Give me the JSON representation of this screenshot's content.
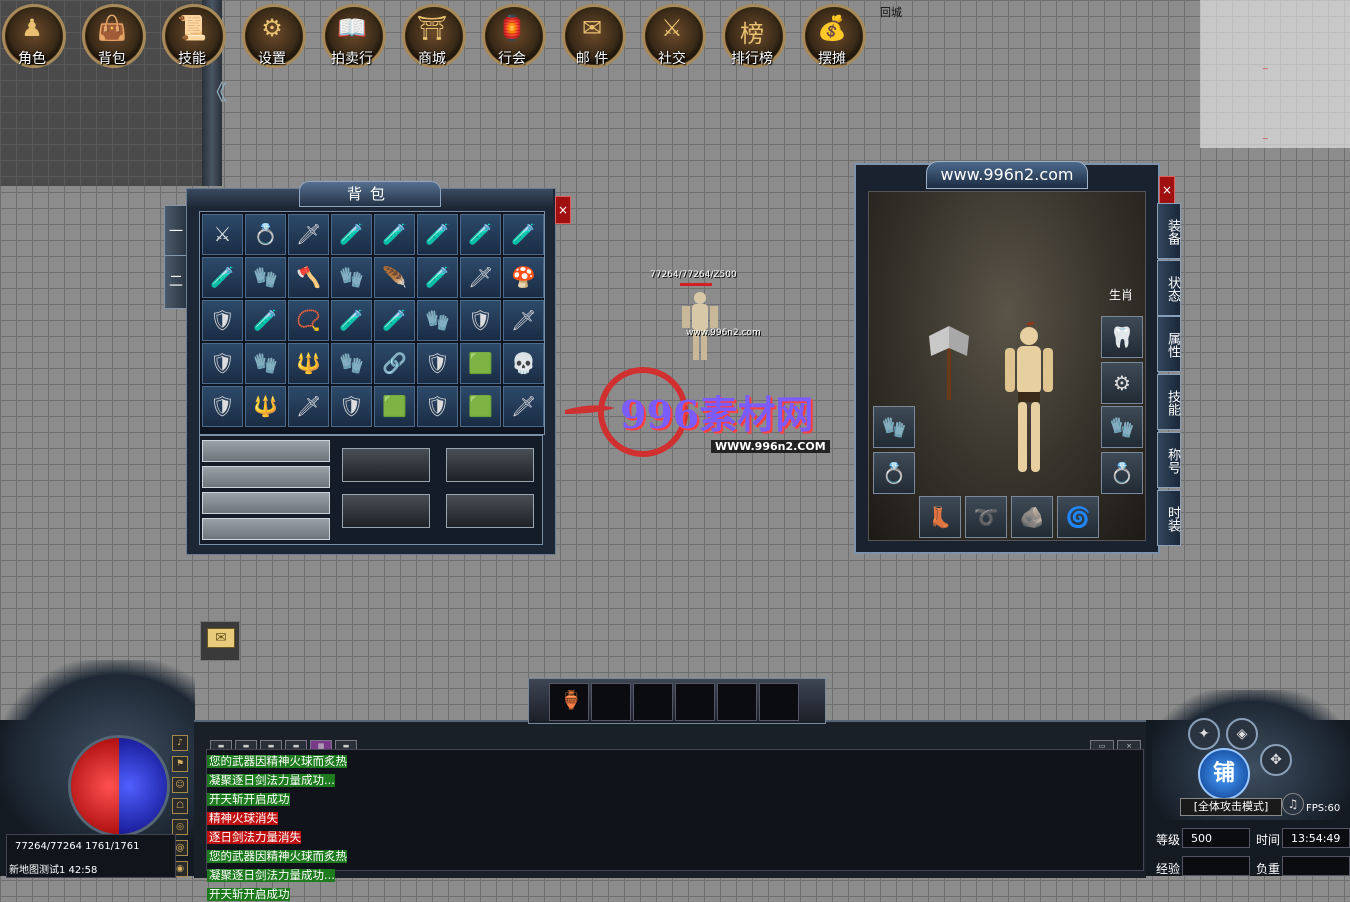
{
  "menu": [
    {
      "label": "角色",
      "icon": "character-icon",
      "glyph": "♟"
    },
    {
      "label": "背包",
      "icon": "bag-icon",
      "glyph": "👜"
    },
    {
      "label": "技能",
      "icon": "skill-icon",
      "glyph": "📜"
    },
    {
      "label": "设置",
      "icon": "gear-icon",
      "glyph": "⚙"
    },
    {
      "label": "拍卖行",
      "icon": "auction-icon",
      "glyph": "📖"
    },
    {
      "label": "商城",
      "icon": "shop-icon",
      "glyph": "⛩"
    },
    {
      "label": "行会",
      "icon": "guild-icon",
      "glyph": "🏮"
    },
    {
      "label": "邮 件",
      "icon": "mail-icon",
      "glyph": "✉"
    },
    {
      "label": "社交",
      "icon": "social-icon",
      "glyph": "⚔"
    },
    {
      "label": "排行榜",
      "icon": "rank-icon",
      "glyph": "榜"
    },
    {
      "label": "摆摊",
      "icon": "stall-icon",
      "glyph": "💰"
    }
  ],
  "return_city": "回城",
  "bag": {
    "title": "背包",
    "side_tabs": [
      "一",
      "二"
    ],
    "close": "×",
    "items": [
      "⚔",
      "💍",
      "🗡",
      "🧪",
      "🧪",
      "🧪",
      "🧪",
      "🧪",
      "🧪",
      "🧤",
      "🪓",
      "🧤",
      "🪶",
      "🧪",
      "🗡",
      "🍄",
      "🛡",
      "🧪",
      "📿",
      "🧪",
      "🧪",
      "🧤",
      "🛡",
      "🗡",
      "🛡",
      "🧤",
      "🔱",
      "🧤",
      "🔗",
      "🛡",
      "🟩",
      "💀",
      "🛡",
      "🔱",
      "🗡",
      "🛡",
      "🟩",
      "🛡",
      "🟩",
      "🗡"
    ]
  },
  "char_panel": {
    "title": "www.996n2.com",
    "close": "×",
    "tabs": [
      "装备",
      "状态",
      "属性",
      "技能",
      "称号",
      "时装"
    ],
    "zodiac": "生肖"
  },
  "player": {
    "hp_text": "77264/77264/Z500",
    "tag": "www.996n2.com"
  },
  "watermark": {
    "title": "996素材网",
    "url": "WWW.996n2.COM"
  },
  "hotbar": {
    "count": "11"
  },
  "status": {
    "hp_mp": "77264/77264   1761/1761",
    "map": "新地图测试1  42:58"
  },
  "chat": {
    "tabs": [
      "",
      "",
      "",
      "",
      "",
      ""
    ],
    "lines": [
      {
        "text": "您的武器因精神火球而炙热",
        "type": "g"
      },
      {
        "text": "凝聚逐日剑法力量成功...",
        "type": "g"
      },
      {
        "text": "开天斩开启成功",
        "type": "g"
      },
      {
        "text": "精神火球消失",
        "type": "r"
      },
      {
        "text": "逐日剑法力量消失",
        "type": "r"
      },
      {
        "text": "您的武器因精神火球而炙热",
        "type": "g"
      },
      {
        "text": "凝聚逐日剑法力量成功...",
        "type": "g"
      },
      {
        "text": "开天斩开启成功",
        "type": "g"
      }
    ]
  },
  "right": {
    "shop": "铺",
    "mode": "[全体攻击模式]",
    "fps": "FPS:60",
    "level_label": "等级",
    "level": "500",
    "time_label": "时间",
    "time": "13:54:49",
    "exp_label": "经验",
    "weight_label": "负重"
  }
}
